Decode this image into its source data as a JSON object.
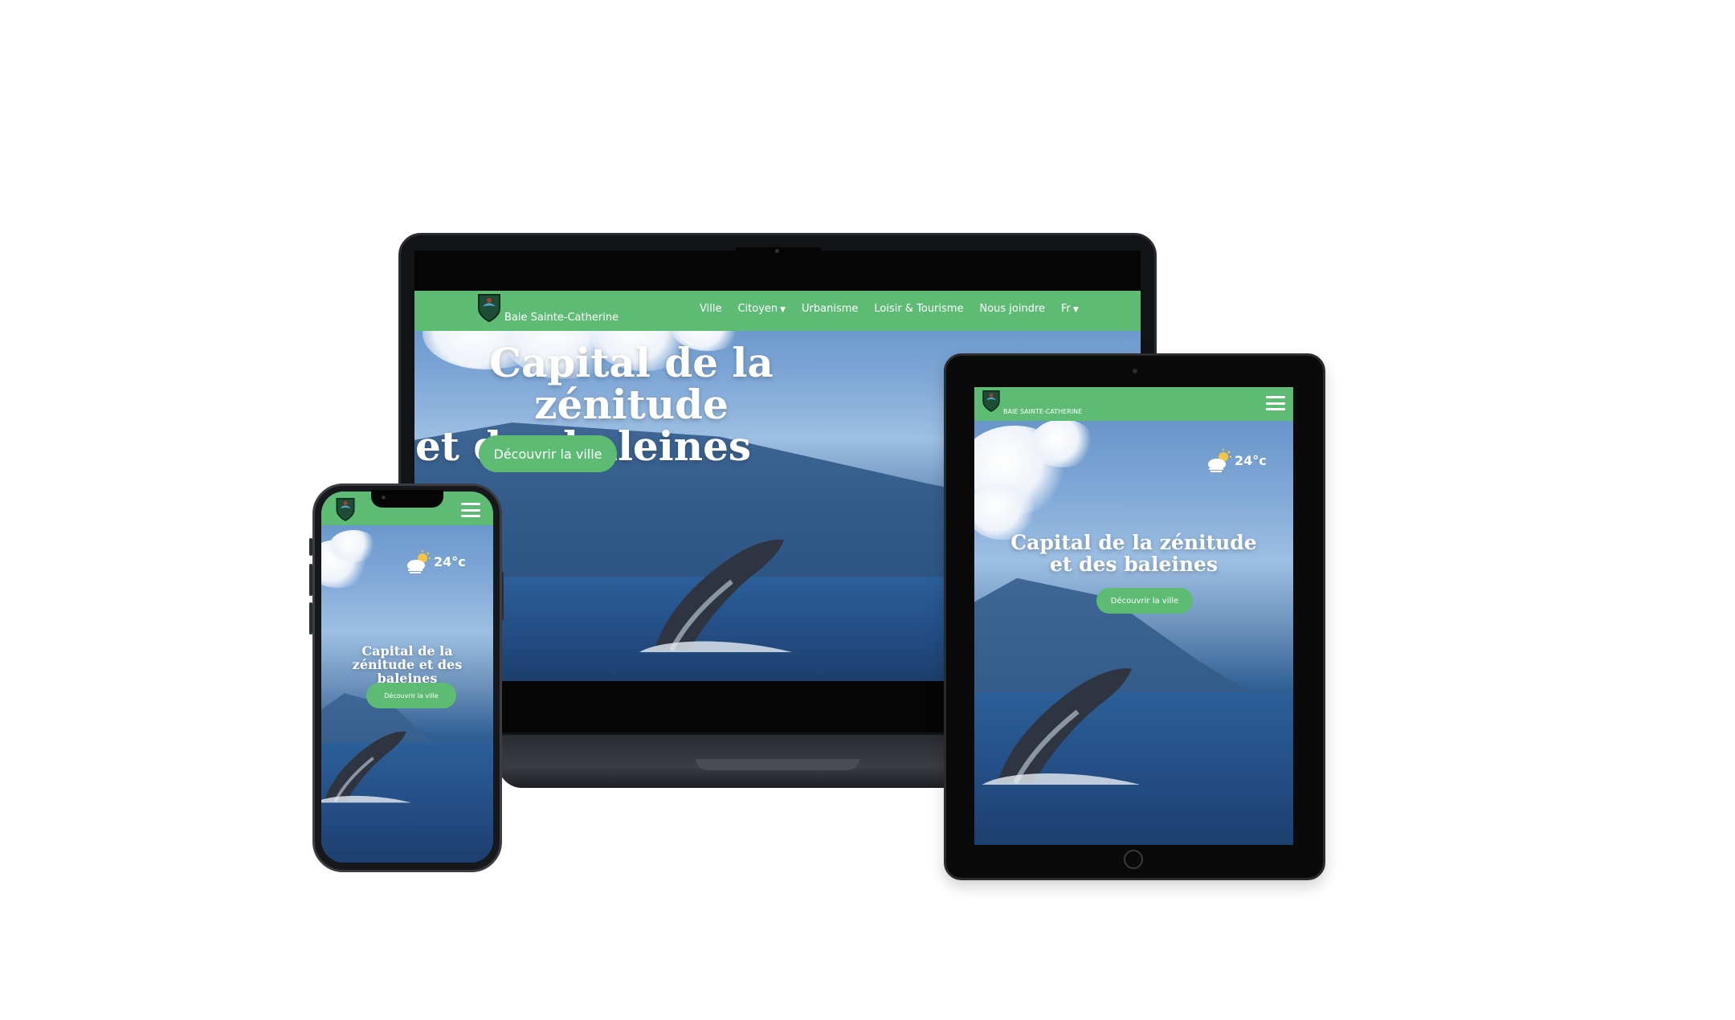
{
  "site": {
    "brand_name": "Baie Sainte-Catherine",
    "brand_name_upper": "BAIE SAINTE-CATHERINE",
    "hero_title_line1": "Capital de la zénitude",
    "hero_title_line2": "et des baleines",
    "hero_title_full": "Capital de la zénitude et des baleines",
    "cta_label": "Découvrir la ville",
    "weather_temp": "24°c",
    "weather_icon": "partly-cloudy-icon",
    "nav": [
      {
        "label": "Ville"
      },
      {
        "label": "Citoyen",
        "dropdown": true
      },
      {
        "label": "Urbanisme"
      },
      {
        "label": "Loisir & Tourisme"
      },
      {
        "label": "Nous joindre"
      },
      {
        "label": "Fr",
        "dropdown": true
      }
    ]
  },
  "colors": {
    "nav_green": "#5dbb74",
    "text_white": "#ffffff",
    "device_black": "#121316"
  }
}
